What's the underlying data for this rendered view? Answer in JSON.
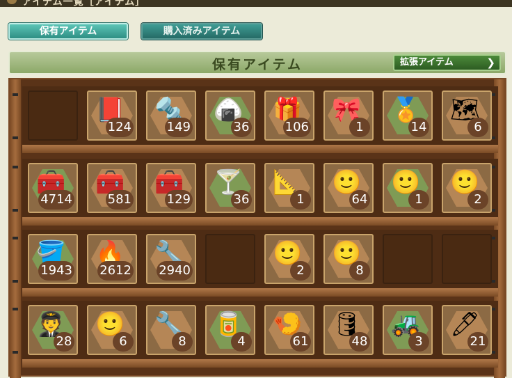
{
  "window": {
    "title": "アイテム一覧［アイテム］"
  },
  "tabs": [
    {
      "label": "保有アイテム"
    },
    {
      "label": "購入済みアイテム"
    }
  ],
  "header": {
    "title": "保有アイテム",
    "expand_label": "拡張アイテム"
  },
  "shelves": [
    [
      {
        "icon": "",
        "count": ""
      },
      {
        "icon": "📕",
        "count": "124"
      },
      {
        "icon": "🔩",
        "count": "149"
      },
      {
        "icon": "🍙",
        "count": "36"
      },
      {
        "icon": "🎁",
        "count": "106"
      },
      {
        "icon": "🎀",
        "count": "1"
      },
      {
        "icon": "🏅",
        "count": "14"
      },
      {
        "icon": "🗺",
        "count": "6"
      }
    ],
    [
      {
        "icon": "🧰",
        "count": "4714"
      },
      {
        "icon": "🧰",
        "count": "581"
      },
      {
        "icon": "🧰",
        "count": "129"
      },
      {
        "icon": "🍸",
        "count": "36"
      },
      {
        "icon": "📐",
        "count": "1"
      },
      {
        "icon": "🙂",
        "count": "64"
      },
      {
        "icon": "🙂",
        "count": "1"
      },
      {
        "icon": "🙂",
        "count": "2"
      }
    ],
    [
      {
        "icon": "🪣",
        "count": "1943"
      },
      {
        "icon": "🔥",
        "count": "2612"
      },
      {
        "icon": "🔧",
        "count": "2940"
      },
      {
        "icon": "",
        "count": ""
      },
      {
        "icon": "🙂",
        "count": "2"
      },
      {
        "icon": "🙂",
        "count": "8"
      },
      {
        "icon": "",
        "count": ""
      },
      {
        "icon": "",
        "count": ""
      }
    ],
    [
      {
        "icon": "🧑‍✈️",
        "count": "28"
      },
      {
        "icon": "🙂",
        "count": "6"
      },
      {
        "icon": "🔧",
        "count": "8"
      },
      {
        "icon": "🥫",
        "count": "4"
      },
      {
        "icon": "🍤",
        "count": "61"
      },
      {
        "icon": "🛢",
        "count": "48"
      },
      {
        "icon": "🚜",
        "count": "3"
      },
      {
        "icon": "🖊",
        "count": "21"
      }
    ]
  ]
}
